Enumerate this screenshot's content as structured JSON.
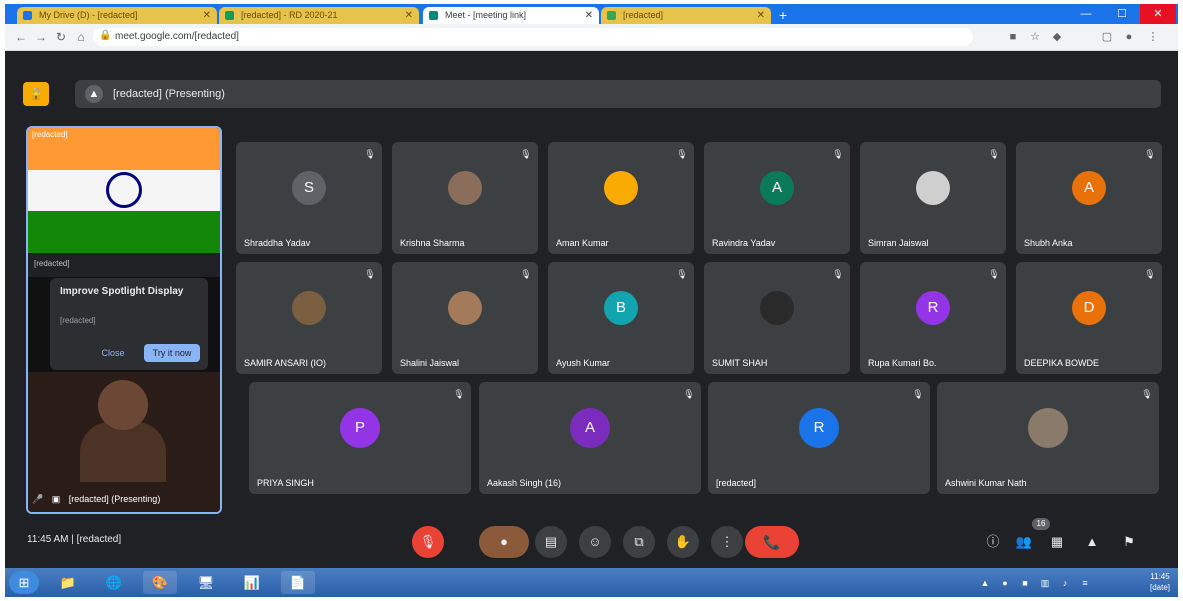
{
  "browser": {
    "tabs": [
      {
        "label": "My Drive (D) - [redacted]",
        "color": "#e6c34a"
      },
      {
        "label": "[redacted] - RD 2020-21",
        "color": "#e6c34a"
      },
      {
        "label": "Meet - [meeting link]",
        "color": "#ffffff"
      },
      {
        "label": "[redacted]",
        "color": "#e6c34a"
      }
    ],
    "new_tab": "+",
    "url": "meet.google.com/[redacted]",
    "window_controls": [
      "—",
      "☐",
      "✕"
    ]
  },
  "meet": {
    "info_text": "[redacted] (Presenting)",
    "lock_badge": "🔒",
    "presenter": {
      "name": "[redacted] (Presenting)",
      "top_text": "[redacted]",
      "dark_text": "[redacted]",
      "popup": {
        "title": "Improve Spotlight Display",
        "body": "[redacted]",
        "none_label": "Close",
        "go_label": "Try it now"
      }
    },
    "participants": [
      {
        "name": "Shraddha Yadav",
        "initial": "S",
        "color": "#5f6368",
        "photo": false
      },
      {
        "name": "Krishna Sharma",
        "initial": "",
        "color": "#8a6d5a",
        "photo": true
      },
      {
        "name": "Aman Kumar",
        "initial": "",
        "color": "#f9ab00",
        "photo": true
      },
      {
        "name": "Ravindra Yadav",
        "initial": "A",
        "color": "#0b7a5a",
        "photo": false
      },
      {
        "name": "Simran Jaiswal",
        "initial": "",
        "color": "#cfcfcf",
        "photo": true
      },
      {
        "name": "Shubh Anka",
        "initial": "A",
        "color": "#e8710a",
        "photo": false
      },
      {
        "name": "SAMIR ANSARI (IO)",
        "initial": "",
        "color": "#7a6040",
        "photo": true
      },
      {
        "name": "Shalini Jaiswal",
        "initial": "",
        "color": "#a37a5a",
        "photo": true
      },
      {
        "name": "Ayush Kumar",
        "initial": "B",
        "color": "#12a4af",
        "photo": false
      },
      {
        "name": "SUMIT SHAH",
        "initial": "",
        "color": "#2a2a2a",
        "photo": true
      },
      {
        "name": "Rupa Kumari Bo.",
        "initial": "R",
        "color": "#9334e6",
        "photo": false
      },
      {
        "name": "DEEPIKA BOWDE",
        "initial": "D",
        "color": "#e8710a",
        "photo": false
      },
      {
        "name": "PRIYA SINGH",
        "initial": "P",
        "color": "#9334e6",
        "photo": false
      },
      {
        "name": "Aakash Singh (16)",
        "initial": "A",
        "color": "#7b2cbf",
        "photo": false
      },
      {
        "name": "[redacted]",
        "initial": "R",
        "color": "#1a73e8",
        "photo": false
      },
      {
        "name": "Ashwini Kumar Nath",
        "initial": "",
        "color": "#8a7a6a",
        "photo": true
      }
    ],
    "bottom": {
      "time_text": "11:45 AM | [redacted]",
      "controls": [
        "mic-off",
        "cam-off",
        "captions",
        "emoji",
        "present",
        "raise-hand",
        "more"
      ],
      "end_call": "📞",
      "right_badge": "16"
    }
  },
  "taskbar": {
    "start": "⊞",
    "apps": [
      "📁",
      "🌐",
      "🎨",
      "🖥",
      "📊",
      "📄"
    ],
    "clock_time": "11:45",
    "clock_date": "[date]"
  }
}
